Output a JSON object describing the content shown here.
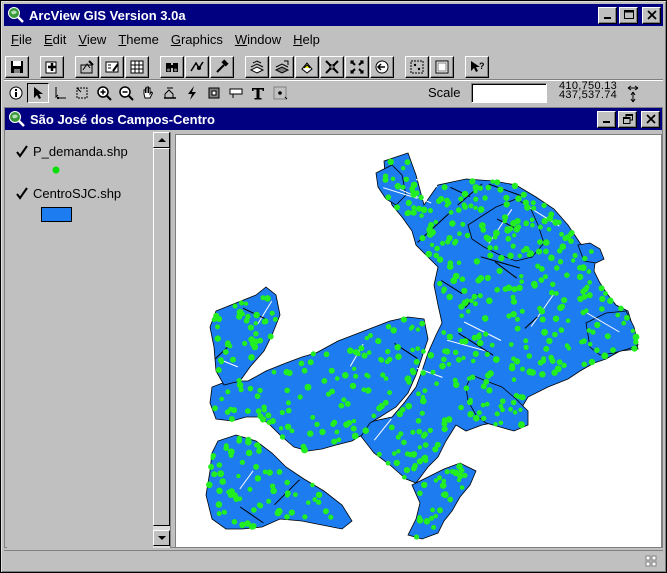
{
  "app": {
    "title": "ArcView GIS Version 3.0a",
    "icon": "arcview-globe-icon"
  },
  "menu": [
    "File",
    "Edit",
    "View",
    "Theme",
    "Graphics",
    "Window",
    "Help"
  ],
  "toolbar": {
    "scale_label": "Scale",
    "scale_value": "",
    "coord_x": "410,750.13",
    "coord_y": "437,537.74"
  },
  "view": {
    "title": "São José dos Campos-Centro"
  },
  "legend": {
    "themes": [
      {
        "name": "P_demanda.shp",
        "checked": true,
        "symbol": "point",
        "color": "#00e000"
      },
      {
        "name": "CentroSJC.shp",
        "checked": true,
        "symbol": "polygon",
        "color": "#1c7cf0"
      }
    ]
  },
  "colors": {
    "title_bar": "#000080",
    "polygon_fill": "#1c7cf0",
    "point_fill": "#22ee22"
  }
}
